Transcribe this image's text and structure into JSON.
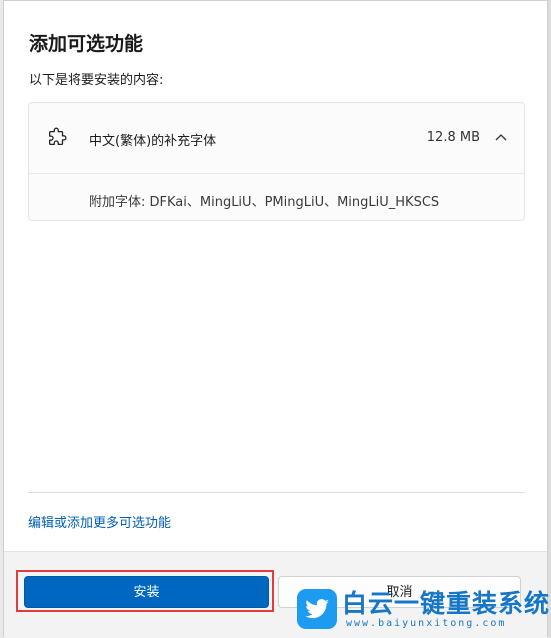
{
  "dialog": {
    "title": "添加可选功能",
    "subtitle": "以下是将要安装的内容:"
  },
  "feature": {
    "icon": "puzzle-piece-icon",
    "name": "中文(繁体)的补充字体",
    "size": "12.8 MB",
    "expanded": true,
    "details": "附加字体: DFKai、MingLiU、PMingLiU、MingLiU_HKSCS"
  },
  "links": {
    "more_features": "编辑或添加更多可选功能"
  },
  "buttons": {
    "install": "安装",
    "cancel": "取消"
  },
  "watermark": {
    "title": "白云一键重装系统",
    "url": "www.baiyunxitong.com"
  },
  "colors": {
    "accent": "#0067c0",
    "link": "#005fb8",
    "highlight": "#e03c3c",
    "watermark": "#1677c8"
  }
}
